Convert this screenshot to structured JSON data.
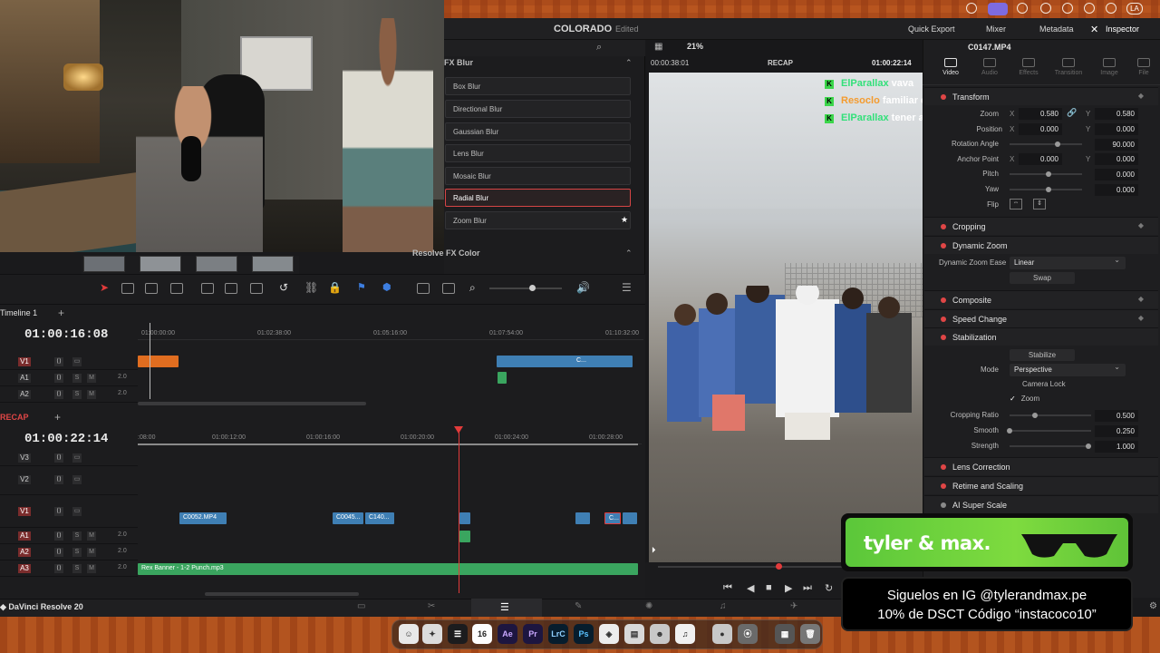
{
  "app": {
    "name": "DaVinci Resolve 20"
  },
  "topbar": {
    "workspace": "COLORADO",
    "status": "Edited",
    "zoom": "21%",
    "quick_export": "Quick Export",
    "mixer": "Mixer",
    "metadata": "Metadata",
    "inspector": "Inspector",
    "clip_name": "C0147.MP4"
  },
  "fx": {
    "header": "FX Blur",
    "items": [
      "Box Blur",
      "Directional Blur",
      "Gaussian Blur",
      "Lens Blur",
      "Mosaic Blur",
      "Radial Blur",
      "Zoom Blur"
    ],
    "selected": "Radial Blur",
    "subheader": "Resolve FX Color"
  },
  "viewer": {
    "timecode_left": "00:00:38:01",
    "timeline_name": "RECAP",
    "timecode_right": "01:00:22:14",
    "chat": [
      {
        "user": "ElParallax",
        "msg": "vava"
      },
      {
        "user": "Resoclo",
        "msg": "familiar csmr"
      },
      {
        "user": "ElParallax",
        "msg": "tener al Ro"
      }
    ]
  },
  "inspector": {
    "tabs": [
      "Video",
      "Audio",
      "Effects",
      "Transition",
      "Image",
      "File"
    ],
    "active_tab": "Video",
    "transform": {
      "title": "Transform",
      "zoom_label": "Zoom",
      "zoom_x": "0.580",
      "zoom_y": "0.580",
      "position_label": "Position",
      "position_x": "0.000",
      "position_y": "0.000",
      "rotation_label": "Rotation Angle",
      "rotation": "90.000",
      "anchor_label": "Anchor Point",
      "anchor_x": "0.000",
      "anchor_y": "0.000",
      "pitch_label": "Pitch",
      "pitch": "0.000",
      "yaw_label": "Yaw",
      "yaw": "0.000",
      "flip_label": "Flip"
    },
    "cropping": "Cropping",
    "dynamic_zoom": {
      "title": "Dynamic Zoom",
      "ease_label": "Dynamic Zoom Ease",
      "ease_value": "Linear",
      "swap": "Swap"
    },
    "composite": "Composite",
    "speed_change": "Speed Change",
    "stabilization": {
      "title": "Stabilization",
      "button": "Stabilize",
      "mode_label": "Mode",
      "mode_value": "Perspective",
      "camera_lock": "Camera Lock",
      "zoom": "Zoom",
      "cropping_ratio_label": "Cropping Ratio",
      "cropping_ratio": "0.500",
      "smooth_label": "Smooth",
      "smooth": "0.250",
      "strength_label": "Strength",
      "strength": "1.000"
    },
    "lens_correction": "Lens Correction",
    "retime": "Retime and Scaling",
    "ai_super_scale": "AI Super Scale"
  },
  "timeline_top": {
    "name": "Timeline 1",
    "timecode": "01:00:16:08",
    "ruler": [
      "01:00:00:00",
      "01:02:38:00",
      "01:05:16:00",
      "01:07:54:00",
      "01:10:32:00"
    ],
    "tracks": [
      {
        "name": "V1",
        "level": ""
      },
      {
        "name": "A1",
        "level": "2.0"
      },
      {
        "name": "A2",
        "level": "2.0"
      }
    ],
    "clip_label": "C..."
  },
  "timeline_main": {
    "name": "RECAP",
    "timecode": "01:00:22:14",
    "ruler": [
      ":08:00",
      "01:00:12:00",
      "01:00:16:00",
      "01:00:20:00",
      "01:00:24:00",
      "01:00:28:00"
    ],
    "video_tracks": [
      "V3",
      "V2",
      "V1"
    ],
    "audio_tracks": [
      {
        "name": "A1",
        "level": "2.0"
      },
      {
        "name": "A2",
        "level": "2.0"
      },
      {
        "name": "A3",
        "level": "2.0"
      }
    ],
    "clips": [
      "C0052.MP4",
      "C0045...",
      "C140...",
      "C..."
    ],
    "audio_clip": "Rex Banner - 1-2 Punch.mp3"
  },
  "ad": {
    "brand": "tyler & max.",
    "line1": "Siguelos en IG @tylerandmax.pe",
    "line2": "10% de DSCT Código “instacoco10”"
  },
  "dock": {
    "badge": "16",
    "apps": [
      "Ae",
      "Pr",
      "LrC",
      "Ps"
    ]
  },
  "menubar": {
    "input": "LA"
  },
  "track_buttons": {
    "solo": "S",
    "mute": "M"
  },
  "colors": {
    "accent_red": "#e04646",
    "clip_blue": "#3f7fb4",
    "clip_green": "#3aa55f",
    "brand_green": "#6fd13d"
  }
}
